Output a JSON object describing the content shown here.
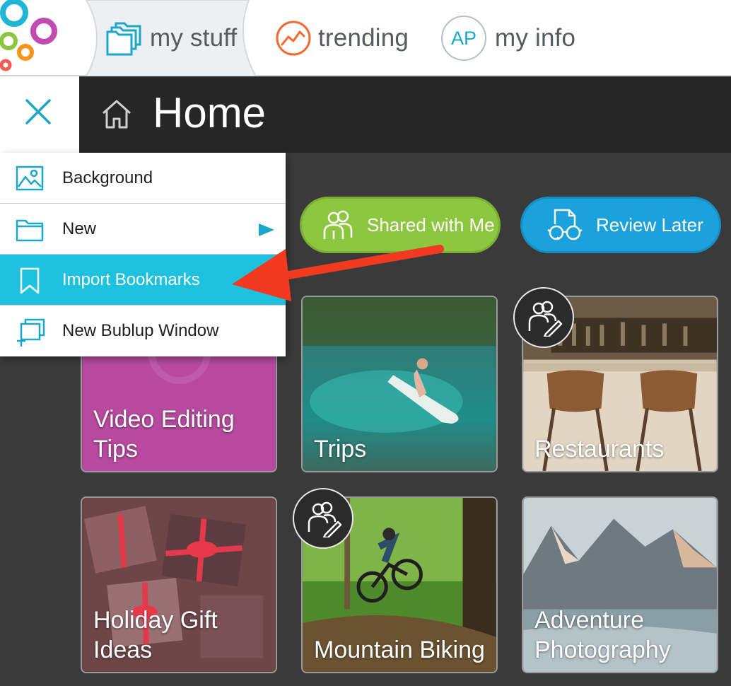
{
  "topbar": {
    "tabs": [
      {
        "label": "my stuff",
        "icon": "folders-icon",
        "active": true
      },
      {
        "label": "trending",
        "icon": "trending-icon"
      },
      {
        "label": "my info",
        "icon": "avatar",
        "avatar_initials": "AP"
      }
    ]
  },
  "header": {
    "title": "Home",
    "close_icon": "close-icon",
    "home_icon": "home-icon"
  },
  "menu": {
    "items": [
      {
        "label": "Background",
        "icon": "image-icon"
      },
      {
        "label": "New",
        "icon": "folder-icon",
        "submenu_icon": "triangle-right-icon"
      },
      {
        "label": "Import Bookmarks",
        "icon": "bookmark-icon",
        "highlighted": true
      },
      {
        "label": "New Bublup Window",
        "icon": "new-window-icon"
      }
    ]
  },
  "quick_filters": [
    {
      "label": "Shared with Me",
      "icon": "people-icon",
      "color": "#8dc63f"
    },
    {
      "label": "Review Later",
      "icon": "glasses-document-icon",
      "color": "#1ba1dc"
    }
  ],
  "tiles": [
    {
      "label_lines": [
        "Video Editing",
        "Tips"
      ]
    },
    {
      "label_lines": [
        "Trips"
      ]
    },
    {
      "label_lines": [
        "Restaurants"
      ],
      "shared": true
    },
    {
      "label_lines": [
        "Holiday Gift",
        "Ideas"
      ]
    },
    {
      "label_lines": [
        "Mountain Biking"
      ],
      "shared": true
    },
    {
      "label_lines": [
        "Adventure",
        "Photography"
      ]
    }
  ],
  "colors": {
    "accent": "#1ec1df",
    "annotation_arrow": "#f23a20",
    "header_bg": "#262626",
    "content_bg": "#3a3a3a"
  }
}
